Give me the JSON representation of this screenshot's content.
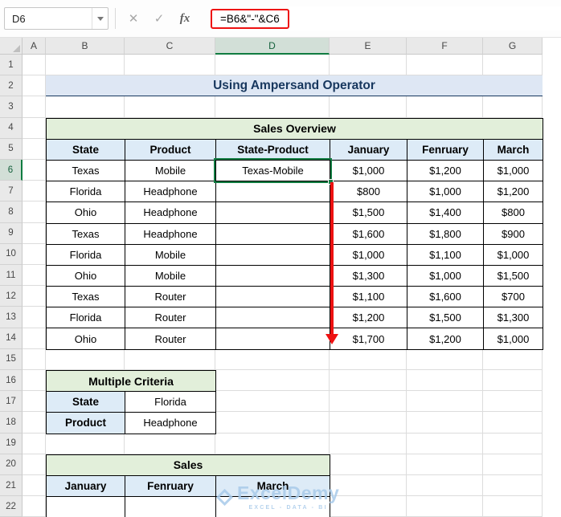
{
  "formula_bar": {
    "name_box": "D6",
    "cancel_glyph": "✕",
    "enter_glyph": "✓",
    "fx_glyph": "fx",
    "formula": "=B6&\"-\"&C6"
  },
  "grid": {
    "column_letters": [
      "A",
      "B",
      "C",
      "D",
      "E",
      "F",
      "G"
    ],
    "row_numbers": [
      1,
      2,
      3,
      4,
      5,
      6,
      7,
      8,
      9,
      10,
      11,
      12,
      13,
      14,
      15,
      16,
      17,
      18,
      19,
      20,
      21,
      22
    ],
    "selected_column": "D",
    "selected_row": 6,
    "selected_cell": "D6"
  },
  "title_banner": "Using Ampersand Operator",
  "sales_table": {
    "title": "Sales Overview",
    "headers": [
      "State",
      "Product",
      "State-Product",
      "January",
      "Fenruary",
      "March"
    ],
    "rows": [
      [
        "Texas",
        "Mobile",
        "Texas-Mobile",
        "$1,000",
        "$1,200",
        "$1,000"
      ],
      [
        "Florida",
        "Headphone",
        "",
        "$800",
        "$1,000",
        "$1,200"
      ],
      [
        "Ohio",
        "Headphone",
        "",
        "$1,500",
        "$1,400",
        "$800"
      ],
      [
        "Texas",
        "Headphone",
        "",
        "$1,600",
        "$1,800",
        "$900"
      ],
      [
        "Florida",
        "Mobile",
        "",
        "$1,000",
        "$1,100",
        "$1,000"
      ],
      [
        "Ohio",
        "Mobile",
        "",
        "$1,300",
        "$1,000",
        "$1,500"
      ],
      [
        "Texas",
        "Router",
        "",
        "$1,100",
        "$1,600",
        "$700"
      ],
      [
        "Florida",
        "Router",
        "",
        "$1,200",
        "$1,500",
        "$1,300"
      ],
      [
        "Ohio",
        "Router",
        "",
        "$1,700",
        "$1,200",
        "$1,000"
      ]
    ]
  },
  "criteria_table": {
    "title": "Multiple Criteria",
    "rows": [
      [
        "State",
        "Florida"
      ],
      [
        "Product",
        "Headphone"
      ]
    ]
  },
  "sales_summary_table": {
    "title": "Sales",
    "headers": [
      "January",
      "Fenruary",
      "March"
    ],
    "rows": [
      [
        "",
        "",
        ""
      ]
    ]
  },
  "watermark": {
    "name": "ExcelDemy",
    "tagline": "EXCEL - DATA - BI"
  },
  "colors": {
    "accent_green": "#107C41",
    "gridline": "#DCDCDC",
    "header_bg": "#E9E9E9",
    "selected_header_bg": "#D2DFD7",
    "table_border": "#000000",
    "green_fill": "#E2EFDA",
    "blue_fill": "#DDEBF7",
    "banner_fill": "#DEE7F4",
    "banner_text": "#17375E",
    "red": "#EE1111",
    "watermark_blue": "#A9CBEA"
  }
}
